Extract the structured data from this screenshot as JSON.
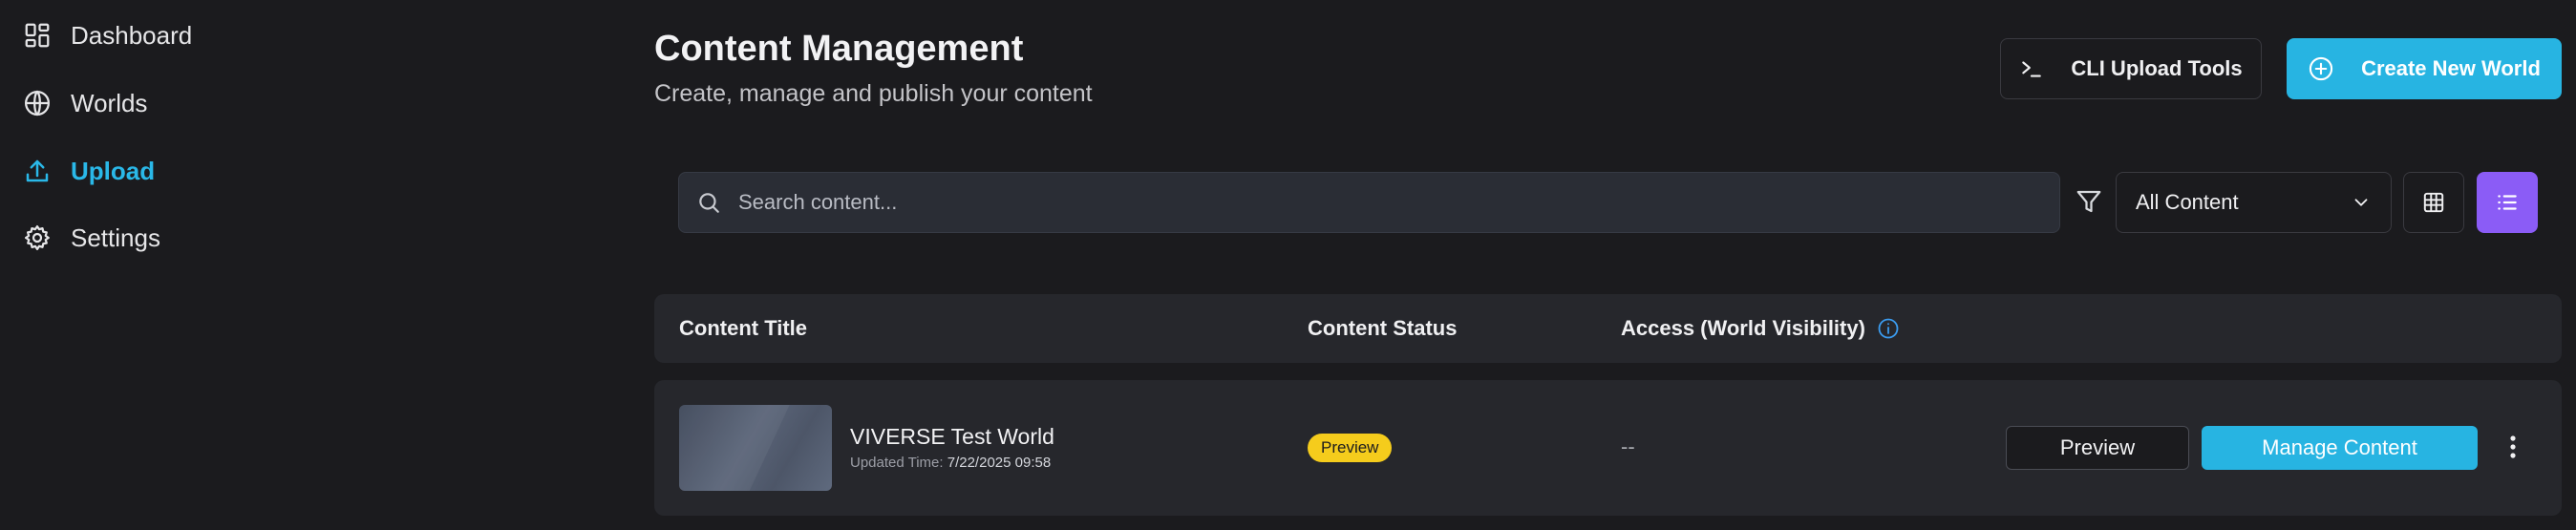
{
  "sidebar": {
    "items": [
      {
        "label": "Dashboard",
        "icon": "dashboard-icon",
        "active": false
      },
      {
        "label": "Worlds",
        "icon": "globe-icon",
        "active": false
      },
      {
        "label": "Upload",
        "icon": "upload-icon",
        "active": true
      },
      {
        "label": "Settings",
        "icon": "gear-icon",
        "active": false
      }
    ]
  },
  "header": {
    "title": "Content Management",
    "subtitle": "Create, manage and publish your content",
    "cli_button": "CLI Upload Tools",
    "create_button": "Create New World"
  },
  "toolbar": {
    "search_placeholder": "Search content...",
    "filter_value": "All Content"
  },
  "table": {
    "columns": [
      "Content Title",
      "Content Status",
      "Access (World Visibility)"
    ],
    "rows": [
      {
        "title": "VIVERSE Test World",
        "updated_label": "Updated Time:",
        "updated_value": "7/22/2025 09:58",
        "status": "Preview",
        "access": "--",
        "preview_button": "Preview",
        "manage_button": "Manage Content"
      }
    ]
  },
  "colors": {
    "background": "#1b1b1e",
    "accent": "#27b4e2",
    "active_view": "#8b5cf6",
    "preview_badge": "#f5cc1c",
    "panel": "#26272c"
  }
}
